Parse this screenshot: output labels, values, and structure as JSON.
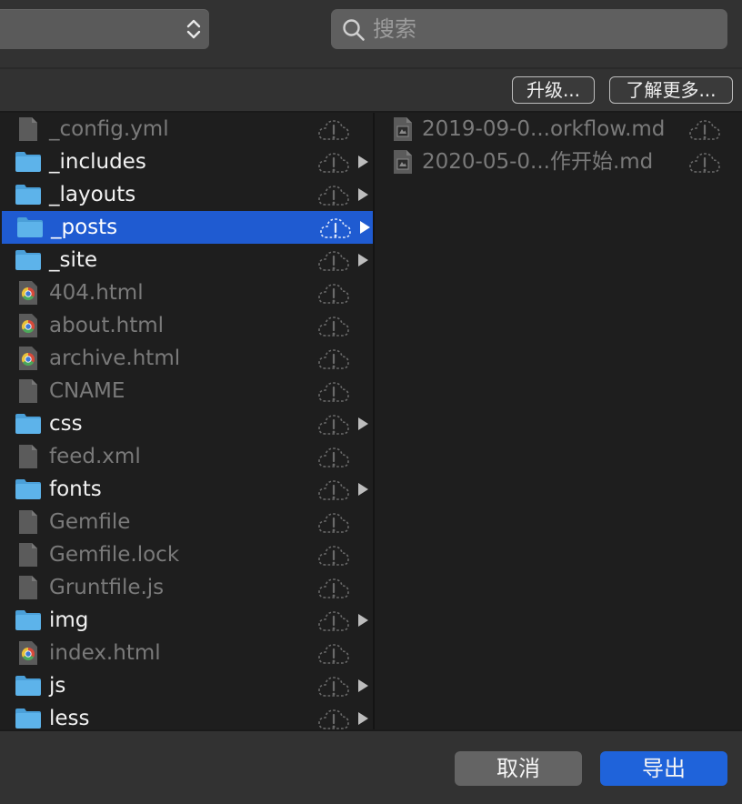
{
  "search": {
    "placeholder": "搜索"
  },
  "toolbar": {
    "upgrade_label": "升级...",
    "learn_more_label": "了解更多..."
  },
  "column1": {
    "items": [
      {
        "name": "_config.yml",
        "kind": "file",
        "icon": "document-icon"
      },
      {
        "name": "_includes",
        "kind": "folder",
        "icon": "folder-icon"
      },
      {
        "name": "_layouts",
        "kind": "folder",
        "icon": "folder-icon"
      },
      {
        "name": "_posts",
        "kind": "folder",
        "icon": "folder-icon",
        "selected": true
      },
      {
        "name": "_site",
        "kind": "folder",
        "icon": "folder-icon"
      },
      {
        "name": "404.html",
        "kind": "html",
        "icon": "chrome-html-icon"
      },
      {
        "name": "about.html",
        "kind": "html",
        "icon": "chrome-html-icon"
      },
      {
        "name": "archive.html",
        "kind": "html",
        "icon": "chrome-html-icon"
      },
      {
        "name": "CNAME",
        "kind": "file",
        "icon": "document-icon"
      },
      {
        "name": "css",
        "kind": "folder",
        "icon": "folder-icon"
      },
      {
        "name": "feed.xml",
        "kind": "file",
        "icon": "document-icon"
      },
      {
        "name": "fonts",
        "kind": "folder",
        "icon": "folder-icon"
      },
      {
        "name": "Gemfile",
        "kind": "file",
        "icon": "document-icon"
      },
      {
        "name": "Gemfile.lock",
        "kind": "file",
        "icon": "document-icon"
      },
      {
        "name": "Gruntfile.js",
        "kind": "file",
        "icon": "document-icon"
      },
      {
        "name": "img",
        "kind": "folder",
        "icon": "folder-icon"
      },
      {
        "name": "index.html",
        "kind": "html",
        "icon": "chrome-html-icon"
      },
      {
        "name": "js",
        "kind": "folder",
        "icon": "folder-icon"
      },
      {
        "name": "less",
        "kind": "folder",
        "icon": "folder-icon"
      }
    ]
  },
  "column2": {
    "items": [
      {
        "name": "2019-09-0...orkflow.md",
        "icon": "markdown-file-icon"
      },
      {
        "name": "2020-05-0...作开始.md",
        "icon": "markdown-file-icon"
      }
    ]
  },
  "buttons": {
    "cancel_label": "取消",
    "export_label": "导出"
  },
  "colors": {
    "accent": "#1f5bd1",
    "folder": "#5db3ea",
    "export": "#1f63da"
  }
}
